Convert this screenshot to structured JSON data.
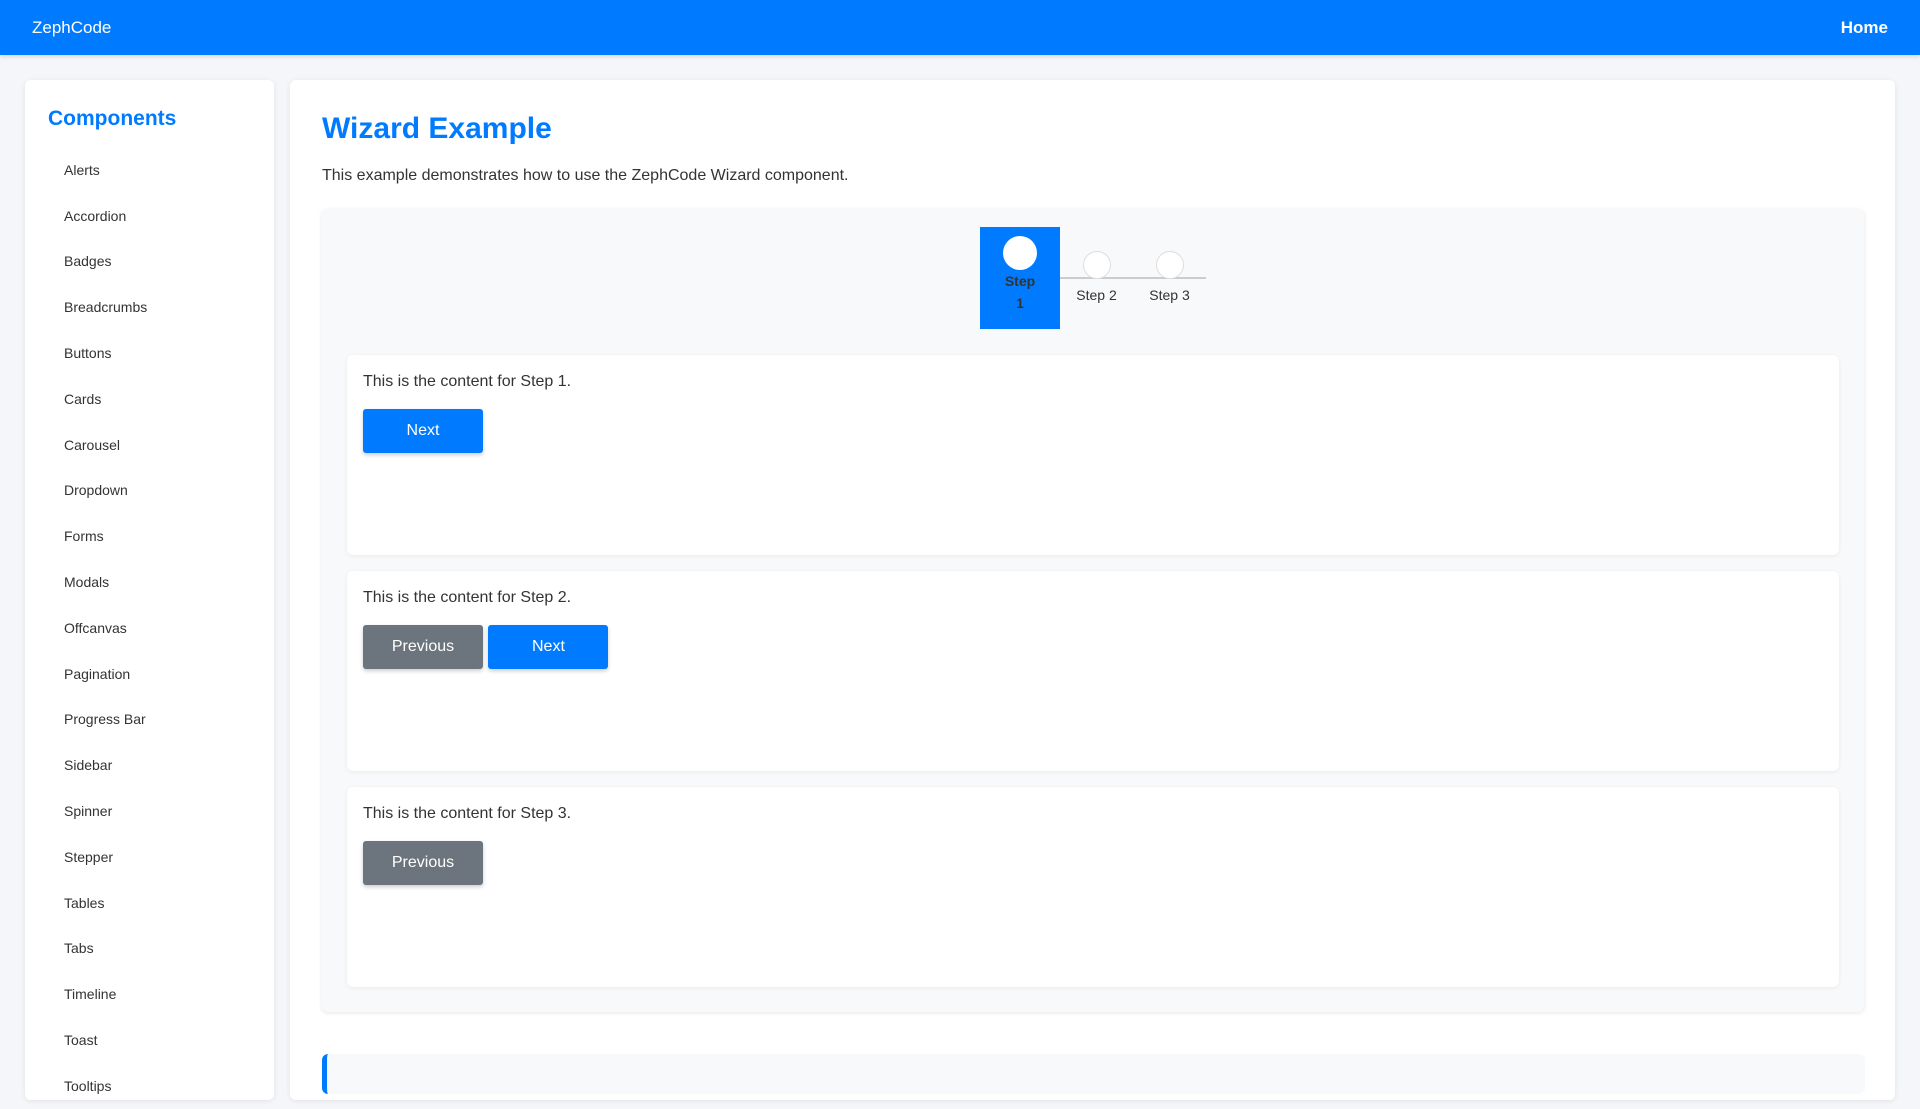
{
  "header": {
    "brand": "ZephCode",
    "home_label": "Home"
  },
  "sidebar": {
    "title": "Components",
    "items": [
      {
        "label": "Alerts"
      },
      {
        "label": "Accordion"
      },
      {
        "label": "Badges"
      },
      {
        "label": "Breadcrumbs"
      },
      {
        "label": "Buttons"
      },
      {
        "label": "Cards"
      },
      {
        "label": "Carousel"
      },
      {
        "label": "Dropdown"
      },
      {
        "label": "Forms"
      },
      {
        "label": "Modals"
      },
      {
        "label": "Offcanvas"
      },
      {
        "label": "Pagination"
      },
      {
        "label": "Progress Bar"
      },
      {
        "label": "Sidebar"
      },
      {
        "label": "Spinner"
      },
      {
        "label": "Stepper"
      },
      {
        "label": "Tables"
      },
      {
        "label": "Tabs"
      },
      {
        "label": "Timeline"
      },
      {
        "label": "Toast"
      },
      {
        "label": "Tooltips"
      }
    ]
  },
  "main": {
    "title": "Wizard Example",
    "description": "This example demonstrates how to use the ZephCode Wizard component."
  },
  "wizard": {
    "steps": [
      {
        "label": "Step 1",
        "active": true
      },
      {
        "label": "Step 2",
        "active": false
      },
      {
        "label": "Step 3",
        "active": false
      }
    ],
    "panels": [
      {
        "text": "This is the content for Step 1.",
        "next_label": "Next"
      },
      {
        "text": "This is the content for Step 2.",
        "previous_label": "Previous",
        "next_label": "Next"
      },
      {
        "text": "This is the content for Step 3.",
        "previous_label": "Previous"
      }
    ]
  },
  "colors": {
    "primary": "#007bff",
    "secondary": "#6c757d"
  }
}
